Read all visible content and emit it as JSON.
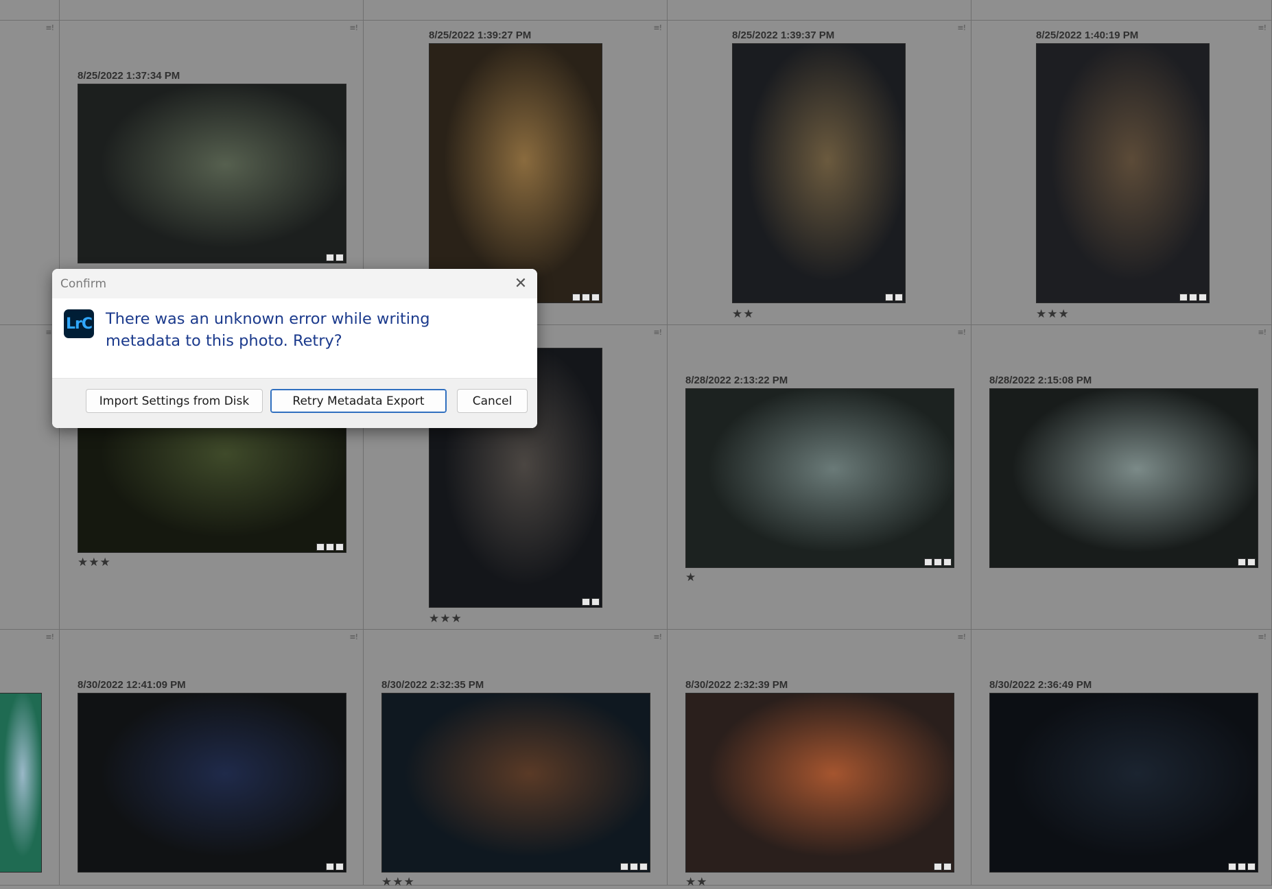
{
  "grid": {
    "cells": [
      {
        "date": "",
        "stars": ""
      },
      {
        "date": "",
        "stars": ""
      },
      {
        "date": "",
        "stars": ""
      },
      {
        "date": "",
        "stars": ""
      },
      {
        "date": "",
        "stars": ""
      },
      {
        "date": "8/25/2022 1:37:34 PM",
        "stars": "",
        "colors": [
          "#1c1f1e",
          "#56604f",
          "#2a2c2c"
        ]
      },
      {
        "date": "8/25/2022 1:39:27 PM",
        "stars": "",
        "colors": [
          "#2a2218",
          "#8a6b3e",
          "#18181a"
        ]
      },
      {
        "date": "8/25/2022 1:39:37 PM",
        "stars": "★★",
        "colors": [
          "#1a1c20",
          "#6b5a3e",
          "#252526"
        ]
      },
      {
        "date": "8/25/2022 1:40:19 PM",
        "stars": "★★★",
        "colors": [
          "#1d1e22",
          "#5c4b38",
          "#26272d"
        ]
      },
      {
        "date": "",
        "stars": ""
      },
      {
        "date": "",
        "stars": "★★★",
        "colors": [
          "#15180f",
          "#3f4a2a",
          "#1e1f1a"
        ]
      },
      {
        "date": "",
        "stars": "★★★",
        "colors": [
          "#14161a",
          "#4b4642",
          "#3b5256"
        ]
      },
      {
        "date": "8/28/2022 2:13:22 PM",
        "stars": "★",
        "colors": [
          "#1c2220",
          "#6a7a78",
          "#1f5a4e"
        ]
      },
      {
        "date": "8/28/2022 2:15:08 PM",
        "stars": "",
        "colors": [
          "#181c1b",
          "#7b8a88",
          "#1f5a4e"
        ]
      },
      {
        "date": "",
        "stars": "",
        "colors": [
          "#1f6b52",
          "#9ab8c8",
          "#1c3f34"
        ]
      },
      {
        "date": "8/30/2022 12:41:09 PM",
        "stars": "",
        "colors": [
          "#101214",
          "#1f2a4a",
          "#2a2d33"
        ]
      },
      {
        "date": "8/30/2022 2:32:35 PM",
        "stars": "★★★",
        "colors": [
          "#0f1820",
          "#5a3a26",
          "#1e2a3c"
        ]
      },
      {
        "date": "8/30/2022 2:32:39 PM",
        "stars": "★★",
        "colors": [
          "#2a1f1c",
          "#a5552f",
          "#1c2430"
        ]
      },
      {
        "date": "8/30/2022 2:36:49 PM",
        "stars": "",
        "colors": [
          "#0c0f14",
          "#1b2430",
          "#111418"
        ]
      }
    ]
  },
  "dialog": {
    "title": "Confirm",
    "close_glyph": "✕",
    "app_icon_text": "LrC",
    "message": "There was an unknown error while writing metadata to this photo. Retry?",
    "buttons": {
      "import": "Import Settings from Disk",
      "retry": "Retry Metadata Export",
      "cancel": "Cancel"
    }
  }
}
